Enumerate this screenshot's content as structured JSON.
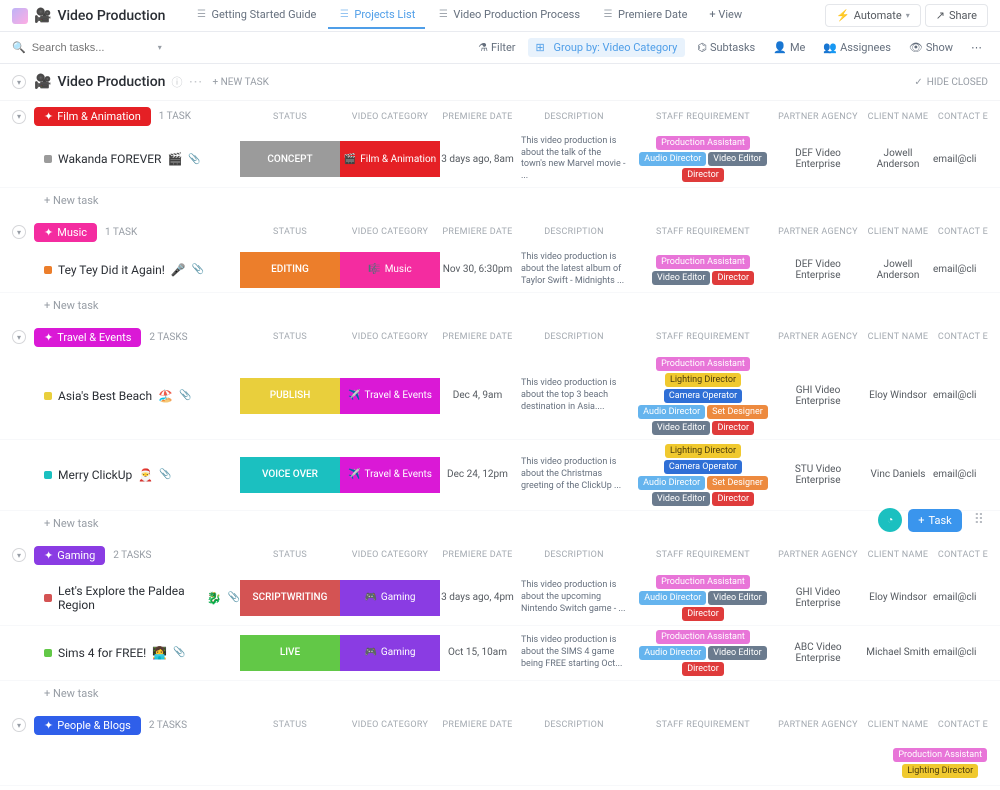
{
  "header": {
    "title": "Video Production",
    "tabs": [
      {
        "label": "Getting Started Guide",
        "active": false
      },
      {
        "label": "Projects List",
        "active": true
      },
      {
        "label": "Video Production Process",
        "active": false
      },
      {
        "label": "Premiere Date",
        "active": false
      },
      {
        "label": "+ View",
        "active": false,
        "isAdd": true
      }
    ],
    "automate": "Automate",
    "share": "Share"
  },
  "toolbar": {
    "search_placeholder": "Search tasks...",
    "filter": "Filter",
    "group_by": "Group by: Video Category",
    "subtasks": "Subtasks",
    "me": "Me",
    "assignees": "Assignees",
    "show": "Show"
  },
  "list": {
    "title": "Video Production",
    "new_task": "+ NEW TASK",
    "hide_closed": "HIDE CLOSED"
  },
  "columns": [
    "STATUS",
    "VIDEO CATEGORY",
    "PREMIERE DATE",
    "DESCRIPTION",
    "STAFF REQUIREMENT",
    "PARTNER AGENCY",
    "CLIENT NAME",
    "CONTACT E"
  ],
  "staff_colors": {
    "Production Assistant": "#e875d8",
    "Audio Director": "#65b4ee",
    "Video Editor": "#6b7b8e",
    "Director": "#df3b3b",
    "Lighting Director": "#f0c92f",
    "Camera Operator": "#2f6fd6",
    "Set Designer": "#ed8a3f"
  },
  "groups": [
    {
      "name": "Film & Animation",
      "color": "#e52025",
      "pill_bg": "#e52025",
      "task_count": "1 TASK",
      "tasks": [
        {
          "name": "Wakanda FOREVER",
          "emoji": "🎬",
          "dot": "#9b9b9b",
          "status": {
            "label": "CONCEPT",
            "bg": "#9b9b9b"
          },
          "category": {
            "label": "Film & Animation",
            "bg": "#e52025",
            "emoji": "🎬"
          },
          "premiere": "3 days ago, 8am",
          "description": "This video production is about the talk of the town's new Marvel movie - ...",
          "staff": [
            "Production Assistant",
            "Audio Director",
            "Video Editor",
            "Director"
          ],
          "agency": "DEF Video Enterprise",
          "client": "Jowell Anderson",
          "contact": "email@cli"
        }
      ]
    },
    {
      "name": "Music",
      "color": "#f42ca0",
      "pill_bg": "#f42ca0",
      "task_count": "1 TASK",
      "tasks": [
        {
          "name": "Tey Tey Did it Again!",
          "emoji": "🎤",
          "dot": "#ec7e2b",
          "status": {
            "label": "EDITING",
            "bg": "#ec7e2b"
          },
          "category": {
            "label": "Music",
            "bg": "#f42ca0",
            "emoji": "🎼"
          },
          "premiere": "Nov 30, 6:30pm",
          "description": "This video production is about the latest album of Taylor Swift - Midnights ...",
          "staff": [
            "Production Assistant",
            "Video Editor",
            "Director"
          ],
          "agency": "DEF Video Enterprise",
          "client": "Jowell Anderson",
          "contact": "email@cli"
        }
      ]
    },
    {
      "name": "Travel & Events",
      "color": "#da19d6",
      "pill_bg": "#da19d6",
      "task_count": "2 TASKS",
      "tasks": [
        {
          "name": "Asia's Best Beach",
          "emoji": "🏖️",
          "dot": "#e9cf3c",
          "status": {
            "label": "PUBLISH",
            "bg": "#e9cf3c"
          },
          "category": {
            "label": "Travel & Events",
            "bg": "#da19d6",
            "emoji": "✈️"
          },
          "premiere": "Dec 4, 9am",
          "description": "This video production is about the top 3 beach destination in Asia....",
          "staff": [
            "Production Assistant",
            "Lighting Director",
            "Camera Operator",
            "Audio Director",
            "Set Designer",
            "Video Editor",
            "Director"
          ],
          "agency": "GHI Video Enterprise",
          "client": "Eloy Windsor",
          "contact": "email@cli"
        },
        {
          "name": "Merry ClickUp",
          "emoji": "🎅",
          "dot": "#1bc0c0",
          "status": {
            "label": "VOICE OVER",
            "bg": "#1bc0c0"
          },
          "category": {
            "label": "Travel & Events",
            "bg": "#da19d6",
            "emoji": "✈️"
          },
          "premiere": "Dec 24, 12pm",
          "description": "This video production is about the Christmas greeting of the ClickUp ...",
          "staff": [
            "Lighting Director",
            "Camera Operator",
            "Audio Director",
            "Set Designer",
            "Video Editor",
            "Director"
          ],
          "agency": "STU Video Enterprise",
          "client": "Vinc Daniels",
          "contact": "email@cli"
        }
      ]
    },
    {
      "name": "Gaming",
      "color": "#8a3ce3",
      "pill_bg": "#8a3ce3",
      "task_count": "2 TASKS",
      "tasks": [
        {
          "name": "Let's Explore the Paldea Region",
          "emoji": "🐉",
          "dot": "#d45353",
          "status": {
            "label": "SCRIPTWRITING",
            "bg": "#d45353"
          },
          "category": {
            "label": "Gaming",
            "bg": "#8a3ce3",
            "emoji": "🎮"
          },
          "premiere": "3 days ago, 4pm",
          "description": "This video production is about the upcoming Nintendo Switch game - ...",
          "staff": [
            "Production Assistant",
            "Audio Director",
            "Video Editor",
            "Director"
          ],
          "agency": "GHI Video Enterprise",
          "client": "Eloy Windsor",
          "contact": "email@cli"
        },
        {
          "name": "Sims 4 for FREE!",
          "emoji": "👩‍💻",
          "dot": "#62c847",
          "status": {
            "label": "LIVE",
            "bg": "#62c847"
          },
          "category": {
            "label": "Gaming",
            "bg": "#8a3ce3",
            "emoji": "🎮"
          },
          "premiere": "Oct 15, 10am",
          "description": "This video production is about the SIMS 4 game being FREE starting Oct...",
          "staff": [
            "Production Assistant",
            "Audio Director",
            "Video Editor",
            "Director"
          ],
          "agency": "ABC Video Enterprise",
          "client": "Michael Smith",
          "contact": "email@cli"
        }
      ]
    },
    {
      "name": "People & Blogs",
      "color": "#2f5fea",
      "pill_bg": "#2f5fea",
      "task_count": "2 TASKS",
      "tasks": [
        {
          "name": "",
          "partial": true,
          "staff": [
            "Production Assistant",
            "Lighting Director"
          ]
        }
      ]
    }
  ],
  "common": {
    "new_task": "+ New task"
  },
  "fab": {
    "task": "Task"
  }
}
